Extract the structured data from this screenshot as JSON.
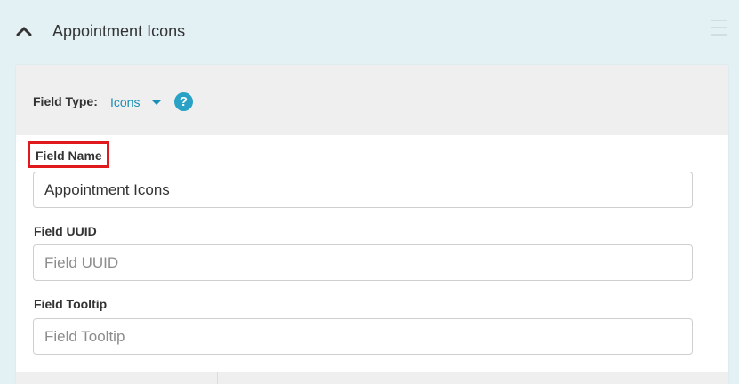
{
  "section": {
    "title": "Appointment Icons",
    "collapse_icon": "chevron-up-icon",
    "drag_icon": "drag-handle-icon"
  },
  "field_type": {
    "label": "Field Type:",
    "value": "Icons",
    "dropdown_icon": "caret-down-icon",
    "help_glyph": "?"
  },
  "fields": {
    "name": {
      "label": "Field Name",
      "value": "Appointment Icons"
    },
    "uuid": {
      "label": "Field UUID",
      "placeholder": "Field UUID",
      "value": ""
    },
    "tooltip": {
      "label": "Field Tooltip",
      "placeholder": "Field Tooltip",
      "value": ""
    }
  },
  "colors": {
    "background": "#e3f1f5",
    "accent": "#1a8fb5",
    "help_badge": "#2aa2c5",
    "highlight_border": "#e0191d"
  }
}
